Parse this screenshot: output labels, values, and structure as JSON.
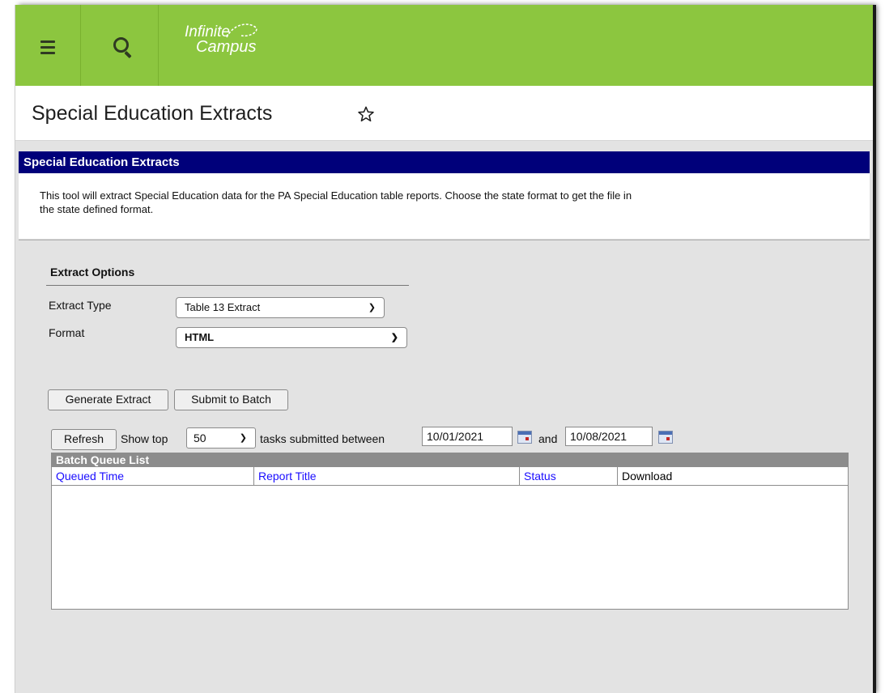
{
  "header": {
    "logo_line1": "Infinite",
    "logo_line2": "Campus"
  },
  "page": {
    "title": "Special Education Extracts"
  },
  "section": {
    "title": "Special Education Extracts",
    "description_line1": "This tool will extract Special Education data for the PA Special Education table reports. Choose the state format to get the file in",
    "description_line2": "the state defined format."
  },
  "options": {
    "title": "Extract Options",
    "extract_type_label": "Extract Type",
    "extract_type_value": "Table 13 Extract",
    "format_label": "Format",
    "format_value": "HTML"
  },
  "actions": {
    "generate": "Generate Extract",
    "submit": "Submit to Batch"
  },
  "batch_filter": {
    "refresh": "Refresh",
    "show_top": "Show top",
    "top_value": "50",
    "submitted_between": "tasks submitted between",
    "start_date": "10/01/2021",
    "and": "and",
    "end_date": "10/08/2021"
  },
  "batch_queue": {
    "title": "Batch Queue List",
    "columns": [
      "Queued Time",
      "Report Title",
      "Status",
      "Download"
    ]
  },
  "colors": {
    "topbar": "#8cc63f",
    "section_header": "#00007a",
    "link": "#1a0dff"
  }
}
